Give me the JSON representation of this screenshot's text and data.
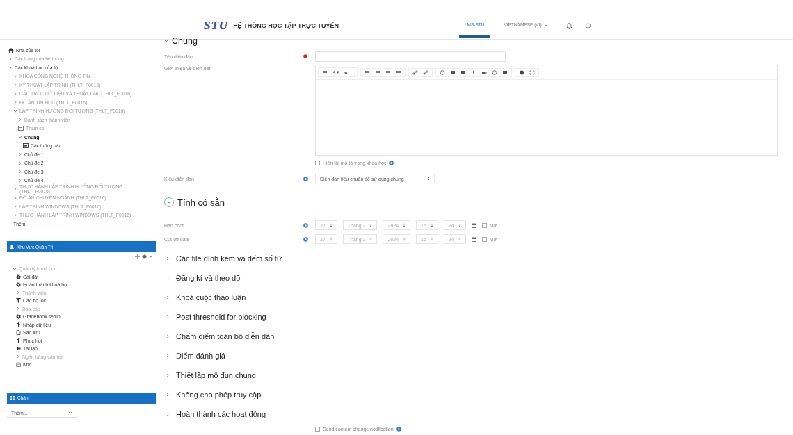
{
  "header": {
    "logo": "STU",
    "title": "HỆ THỐNG HỌC TẬP TRỰC TUYẾN",
    "nav": [
      {
        "label": "LMS-STU",
        "selected": true,
        "kind": "link"
      },
      {
        "label": "VIETNAMESE (VI)",
        "selected": false,
        "kind": "menu"
      }
    ]
  },
  "navigation": [
    {
      "label": "Nhà của tôi",
      "kind": "home"
    },
    {
      "label": "Các trang của hệ thống",
      "kind": "link",
      "expanded": false
    },
    {
      "label": "Các khoá học của tôi",
      "kind": "text",
      "expanded": true,
      "children": [
        {
          "label": "KHOA CÔNG NGHỆ THÔNG TIN",
          "kind": "link",
          "expanded": false
        },
        {
          "label": "KỸ THUẬT LẬP TRÌNH (THLT_F0016)",
          "kind": "link",
          "expanded": false
        },
        {
          "label": "CẤU TRÚC DỮ LIỆU VÀ THUẬT GIẢI (THLT_F0016)",
          "kind": "link",
          "expanded": false
        },
        {
          "label": "ĐỒ ÁN TIN HỌC (THLT_F0016)",
          "kind": "link",
          "expanded": false
        },
        {
          "label": "LẬP TRÌNH HƯỚNG ĐỐI TƯỢNG (THLT_F0016)",
          "kind": "link",
          "expanded": true,
          "children": [
            {
              "label": "Danh sách thành viên",
              "kind": "link",
              "expanded": false
            },
            {
              "label": "Tham số",
              "kind": "badge"
            },
            {
              "label": "Chung",
              "kind": "current",
              "expanded": true,
              "children": [
                {
                  "label": "Các thông báo",
                  "kind": "forum"
                }
              ]
            },
            {
              "label": "Chủ đề 1",
              "kind": "text",
              "expanded": false
            },
            {
              "label": "Chủ đề 2",
              "kind": "text",
              "expanded": false
            },
            {
              "label": "Chủ đề 3",
              "kind": "text",
              "expanded": false
            },
            {
              "label": "Chủ đề 4",
              "kind": "text",
              "expanded": false
            }
          ]
        },
        {
          "label": "THỰC HÀNH LẬP TRÌNH HƯỚNG ĐỐI TƯỢNG (THLT_F0016)",
          "kind": "link",
          "expanded": false
        },
        {
          "label": "ĐỒ ÁN CHUYÊN NGÀNH (THLT_F0016)",
          "kind": "link",
          "expanded": false
        },
        {
          "label": "LẬP TRÌNH WINDOWS (THLT_F0016)",
          "kind": "link",
          "expanded": false
        },
        {
          "label": "THỰC HÀNH LẬP TRÌNH WINDOWS (THLT_F0016)",
          "kind": "link",
          "expanded": false
        },
        {
          "label": "Thêm",
          "kind": "text"
        }
      ]
    }
  ],
  "admin": {
    "title": "Khu Vực Quản Trị",
    "items": [
      {
        "label": "Quản lý khoá học",
        "kind": "heading"
      },
      {
        "label": "Cài đặt",
        "kind": "gear"
      },
      {
        "label": "Hoàn thành khoá học",
        "kind": "gear"
      },
      {
        "label": "Thành viên",
        "kind": "branch"
      },
      {
        "label": "Các bộ lọc",
        "kind": "filter"
      },
      {
        "label": "Báo cáo",
        "kind": "branch"
      },
      {
        "label": "Gradebook setup",
        "kind": "gear"
      },
      {
        "label": "Nhập dữ liệu",
        "kind": "upload"
      },
      {
        "label": "Sao lưu",
        "kind": "file"
      },
      {
        "label": "Phục hồi",
        "kind": "upload"
      },
      {
        "label": "Tái lập",
        "kind": "back"
      },
      {
        "label": "Ngân hàng câu hỏi",
        "kind": "branch"
      },
      {
        "label": "Kho",
        "kind": "box"
      }
    ]
  },
  "blocks": {
    "title": "Chặn",
    "select": "Thêm..."
  },
  "form": {
    "section": "Chung",
    "name_label": "Tên diễn đàn",
    "intro_label": "Giới thiệu về diễn đàn",
    "editor_text_buttons": [
      "A ▾",
      "B",
      "I"
    ],
    "show_description": {
      "label": "Hiển thị mô tả trong khoá học",
      "checked": false
    },
    "type_label": "Kiểu diễn đàn",
    "type_value": "Diễn đàn tiêu chuẩn để sử dụng chung",
    "availability": {
      "title": "Tính có sẵn",
      "expanded": true,
      "rows": [
        {
          "label": "Hạn chót",
          "parts": [
            "27",
            "Tháng 2",
            "2024",
            "15",
            "24"
          ],
          "enable_label": "Mở",
          "enabled": false
        },
        {
          "label": "Cut-off date",
          "parts": [
            "27",
            "Tháng 2",
            "2024",
            "15",
            "24"
          ],
          "enable_label": "Mở",
          "enabled": false
        }
      ]
    },
    "collapsed_sections": [
      "Các file đính kèm và đếm số từ",
      "Đăng kí và theo dõi",
      "Khoá cuộc thảo luận",
      "Post threshold for blocking",
      "Chấm điểm toàn bộ diễn đàn",
      "Điểm đánh giá",
      "Thiết lập mô đun chung",
      "Không cho phép truy cập",
      "Hoàn thành các hoạt động"
    ],
    "notify": {
      "label": "Send content change notification",
      "checked": false
    }
  }
}
